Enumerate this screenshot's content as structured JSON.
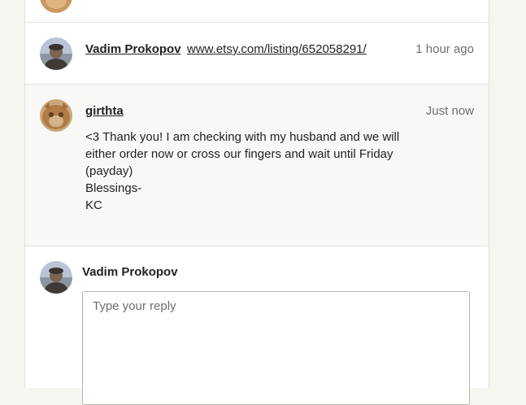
{
  "thread": {
    "messages": [
      {
        "sender": "Vadim Prokopov",
        "link": "www.etsy.com/listing/652058291/",
        "time": "1 hour ago"
      },
      {
        "sender": "girthta",
        "time": "Just now",
        "body_lines": [
          "<3 Thank you! I am checking with my husband and we will",
          "either order now or cross our fingers and wait until Friday",
          "(payday)",
          "",
          "Blessings-",
          "KC"
        ]
      }
    ]
  },
  "reply": {
    "author": "Vadim Prokopov",
    "placeholder": "Type your reply"
  },
  "colors": {
    "page_background": "#f6f5f0",
    "panel_background": "#ffffff",
    "highlight_row": "#f8f8f6",
    "muted_text": "#6e6e6e"
  }
}
